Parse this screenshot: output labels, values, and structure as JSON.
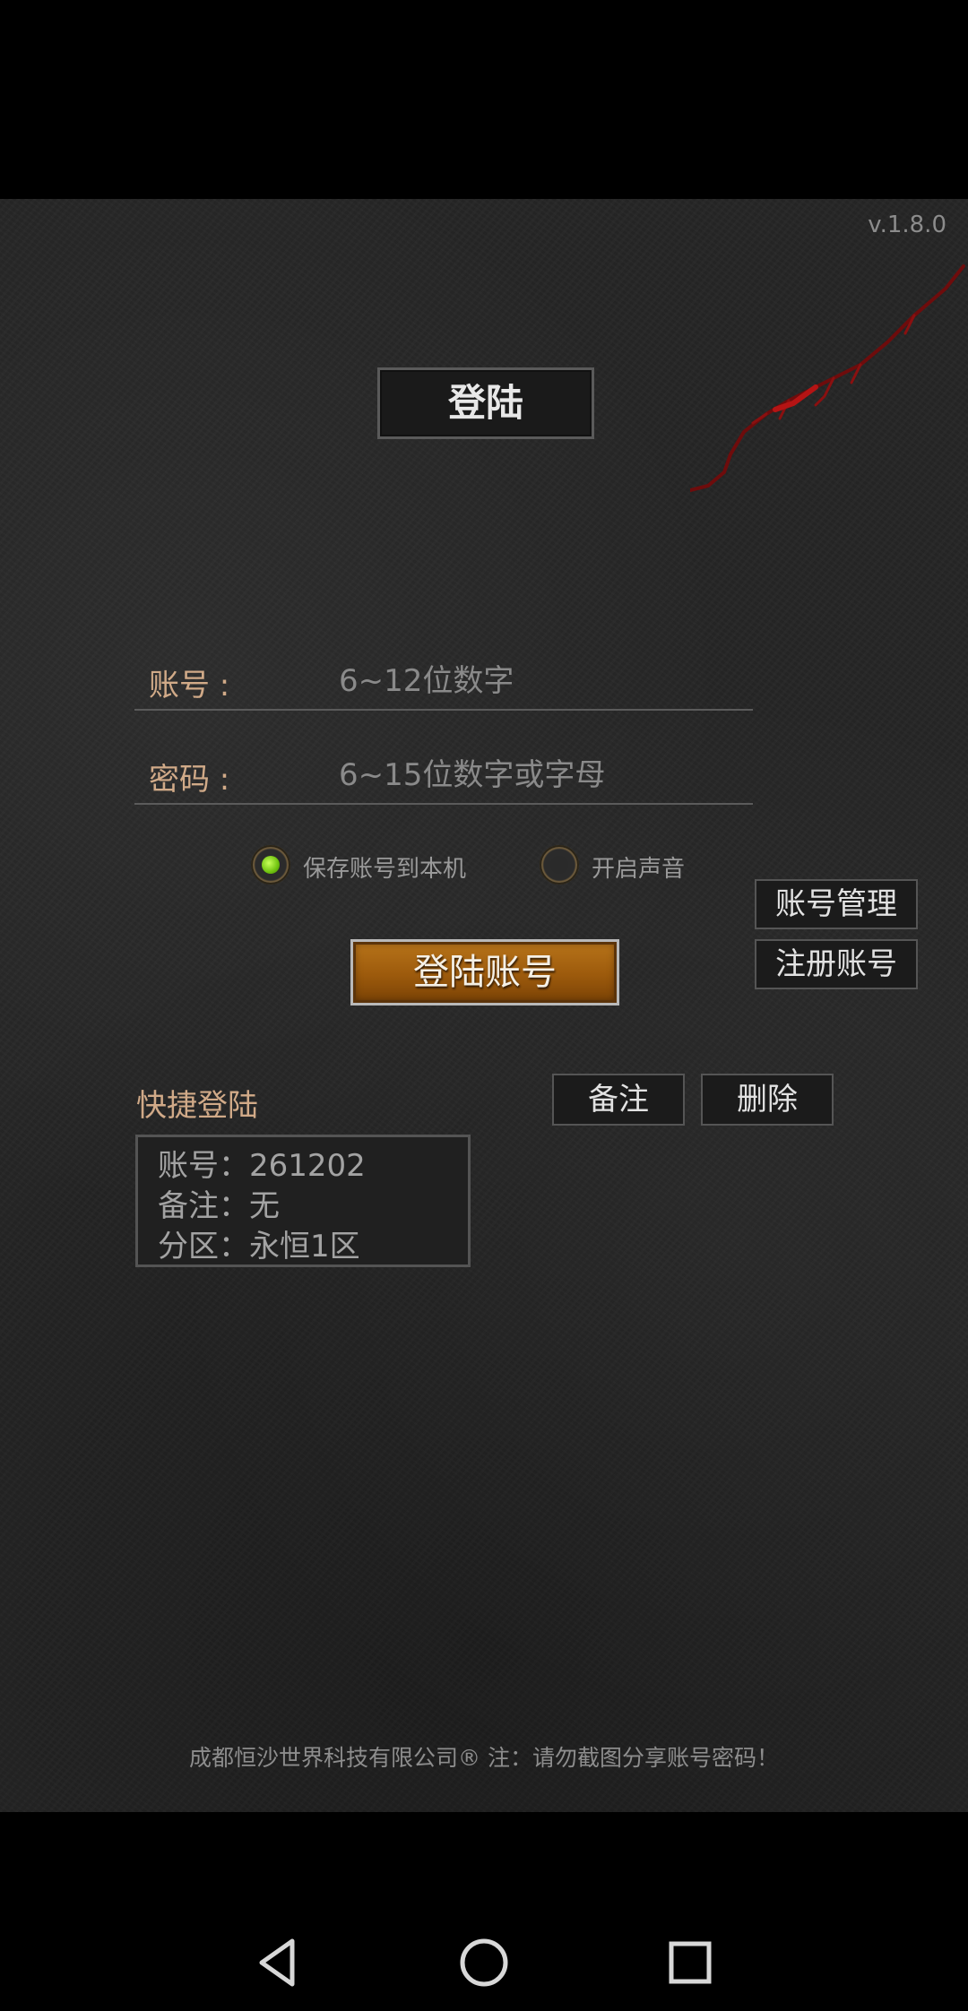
{
  "app": {
    "version": "v.1.8.0",
    "title": "登陆"
  },
  "form": {
    "account_label": "账号 :",
    "account_placeholder": "6~12位数字",
    "password_label": "密码 :",
    "password_placeholder": "6~15位数字或字母",
    "save_account_label": "保存账号到本机",
    "save_account_checked": true,
    "sound_label": "开启声音",
    "sound_checked": false,
    "login_button": "登陆账号"
  },
  "side_buttons": {
    "account_manage": "账号管理",
    "register": "注册账号"
  },
  "quick_login": {
    "title": "快捷登陆",
    "note_button": "备注",
    "delete_button": "删除",
    "entries": [
      {
        "account": "账号：261202",
        "note": "备注：无",
        "zone": "分区：永恒1区"
      }
    ]
  },
  "footer": {
    "text": "成都恒沙世界科技有限公司® 注：请勿截图分享账号密码！"
  },
  "colors": {
    "accent_label": "#d1aa88",
    "login_button": "#9c5a0c",
    "radio_on": "#6fc20f"
  },
  "icons": {
    "back": "triangle-left",
    "home": "circle",
    "recents": "square"
  }
}
